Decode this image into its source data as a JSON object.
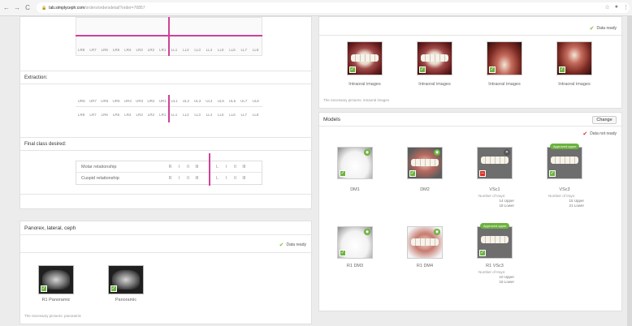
{
  "browser": {
    "back": "←",
    "forward": "→",
    "reload": "C",
    "url_domain": "lab.simplyceph.com",
    "url_path": "/orders/ordersdetail?order=76857",
    "star": "☆",
    "menu": "⋮"
  },
  "left_panel": {
    "top_teeth_row": [
      "LR8",
      "LR7",
      "LR6",
      "LR5",
      "LR4",
      "LR3",
      "LR2",
      "LR1",
      "LL1",
      "LL2",
      "LL3",
      "LL4",
      "LL5",
      "LL6",
      "LL7",
      "LL8"
    ],
    "extraction_label": "Extraction:",
    "extraction_upper": [
      "UR8",
      "UR7",
      "UR6",
      "UR5",
      "UR4",
      "UR3",
      "UR2",
      "UR1",
      "UL1",
      "UL2",
      "UL3",
      "UL4",
      "UL5",
      "UL6",
      "UL7",
      "UL8"
    ],
    "extraction_lower": [
      "LR8",
      "LR7",
      "LR6",
      "LR5",
      "LR4",
      "LR3",
      "LR2",
      "LR1",
      "LL1",
      "LL2",
      "LL3",
      "LL4",
      "LL5",
      "LL6",
      "LL7",
      "LL8"
    ],
    "final_class_label": "Final class desired:",
    "class_rows": [
      {
        "name": "Molar relationship",
        "right": [
          "R",
          "I",
          "II",
          "III"
        ],
        "left": [
          "L",
          "I",
          "II",
          "III"
        ]
      },
      {
        "name": "Cuspid relationship",
        "right": [
          "R",
          "I",
          "II",
          "III"
        ],
        "left": [
          "L",
          "I",
          "II",
          "III"
        ]
      }
    ]
  },
  "pano_panel": {
    "title": "Panorex, lateral, ceph",
    "status": "Data ready",
    "images": [
      {
        "caption": "R1 Panoramic",
        "selected": true
      },
      {
        "caption": "Panoramic",
        "selected": true
      }
    ],
    "note": "The necessary pictures: panoramic"
  },
  "intraoral_panel": {
    "status": "Data ready",
    "images": [
      "Intraoral images",
      "Intraoral images",
      "Intraoral images",
      "Intraoral images"
    ],
    "note": "The necessary pictures: intraoral images"
  },
  "models_panel": {
    "title": "Models",
    "change_label": "Change",
    "status": "Data not ready",
    "approved_label": "Approved upper",
    "cards": [
      {
        "caption": "DM1"
      },
      {
        "caption": "DM2"
      },
      {
        "caption": "VSc1",
        "trays_label": "Number of trays:",
        "upper": "14 Upper",
        "lower": "18 Lower"
      },
      {
        "caption": "VSc3",
        "trays_label": "Number of trays:",
        "upper": "15 Upper",
        "lower": "21 Lower"
      },
      {
        "caption": "R1 DM3"
      },
      {
        "caption": "R1 DM4"
      },
      {
        "caption": "R1 VSc3",
        "trays_label": "Number of trays:",
        "upper": "10 Upper",
        "lower": "18 Lower"
      }
    ]
  },
  "colors": {
    "accent_pink": "#d0409a",
    "ready_green": "#7cbf3a",
    "not_ready_red": "#d93025"
  }
}
